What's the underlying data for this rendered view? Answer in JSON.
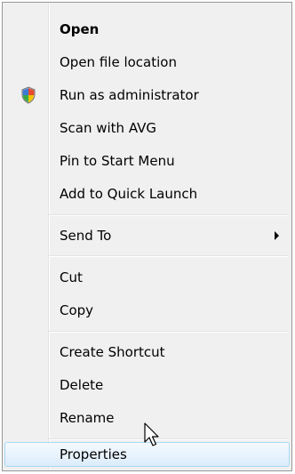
{
  "menu": {
    "items": [
      {
        "label": "Open"
      },
      {
        "label": "Open file location"
      },
      {
        "label": "Run as administrator",
        "icon": "uac-shield-icon"
      },
      {
        "label": "Scan with AVG"
      },
      {
        "label": "Pin to Start Menu"
      },
      {
        "label": "Add to Quick Launch"
      },
      {
        "label": "Send To",
        "has_submenu": true
      },
      {
        "label": "Cut"
      },
      {
        "label": "Copy"
      },
      {
        "label": "Create Shortcut"
      },
      {
        "label": "Delete"
      },
      {
        "label": "Rename"
      },
      {
        "label": "Properties",
        "state": "highlighted"
      }
    ]
  },
  "colors": {
    "menu_background": "#f0f0f0",
    "menu_border": "#979797",
    "highlight_border": "#a8d8f5",
    "highlight_fill": "#dcecfb"
  }
}
